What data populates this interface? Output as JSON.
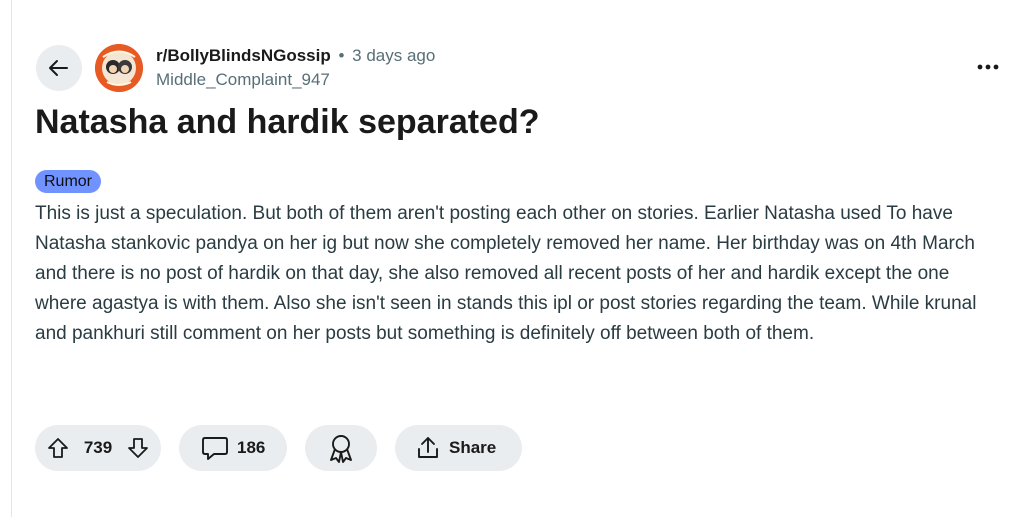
{
  "post": {
    "subreddit": "r/BollyBlindsNGossip",
    "separator": "•",
    "time_ago": "3 days ago",
    "author": "Middle_Complaint_947",
    "title": "Natasha and hardik separated?",
    "flair": "Rumor",
    "body": "This is just a speculation. But both of them aren't posting each other on stories. Earlier Natasha used To have Natasha stankovic pandya on her ig but now she completely removed her name. Her birthday was on 4th March and there is no post of hardik on that day, she also removed all recent posts of her and hardik except the one where agastya is with them. Also she isn't seen in stands this ipl or post stories regarding the team. While krunal and pankhuri still comment on her posts but something is definitely off between both of them."
  },
  "actions": {
    "vote_count": "739",
    "comment_count": "186",
    "share_label": "Share"
  },
  "icons": {
    "back": "arrow-left-icon",
    "more": "more-horizontal-icon",
    "upvote": "arrow-up-icon",
    "downvote": "arrow-down-icon",
    "comment": "speech-bubble-icon",
    "award": "award-ribbon-icon",
    "share": "share-upload-icon"
  },
  "colors": {
    "pill_bg": "#eaedef",
    "flair_bg": "#7193ff",
    "avatar_bg": "#e85a24",
    "muted_text": "#576f76"
  }
}
